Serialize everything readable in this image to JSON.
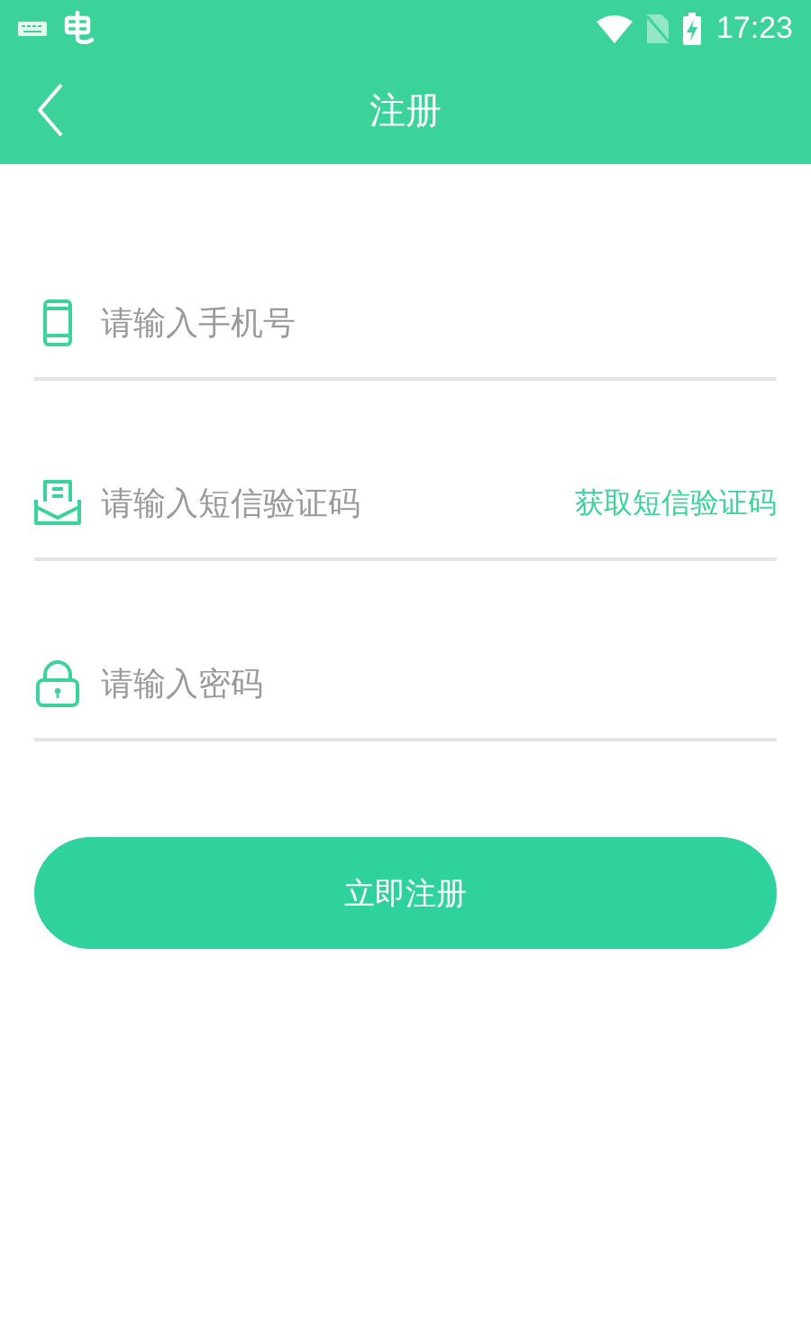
{
  "status_bar": {
    "time": "17:23"
  },
  "toolbar": {
    "title": "注册"
  },
  "fields": [
    {
      "kind": "phone",
      "placeholder": "请输入手机号"
    },
    {
      "kind": "sms",
      "placeholder": "请输入短信验证码",
      "action": "获取短信验证码"
    },
    {
      "kind": "password",
      "placeholder": "请输入密码"
    }
  ],
  "submit_button": "立即注册"
}
